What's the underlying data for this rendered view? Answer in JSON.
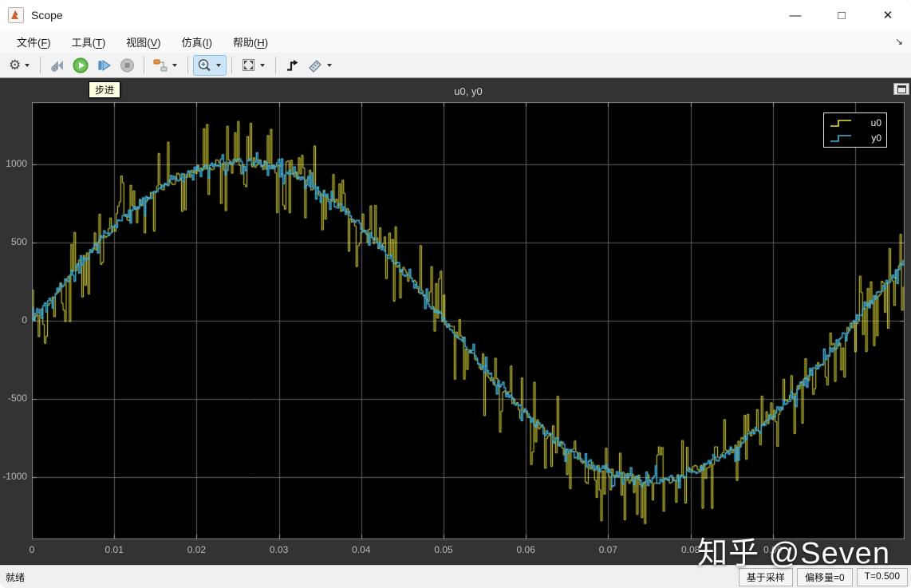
{
  "window": {
    "title": "Scope",
    "controls": {
      "minimize": "—",
      "maximize": "□",
      "close": "✕"
    },
    "menu_overflow_arrow": "↘"
  },
  "menu": {
    "items": [
      {
        "text": "文件",
        "key": "F"
      },
      {
        "text": "工具",
        "key": "T"
      },
      {
        "text": "视图",
        "key": "V"
      },
      {
        "text": "仿真",
        "key": "I"
      },
      {
        "text": "帮助",
        "key": "H"
      }
    ]
  },
  "toolbar": {
    "tooltip": "步进",
    "buttons": [
      "settings",
      "step-back",
      "run",
      "step-forward",
      "stop",
      "signal-selector",
      "zoom",
      "fit-to-view",
      "trigger",
      "measurements"
    ],
    "active_button": "zoom"
  },
  "chart_data": {
    "type": "line",
    "title": "u0, y0",
    "xlim": [
      0,
      0.106
    ],
    "ylim": [
      -1400,
      1400
    ],
    "x_ticks": [
      0,
      0.01,
      0.02,
      0.03,
      0.04,
      0.05,
      0.06,
      0.07,
      0.08,
      0.09
    ],
    "x_tick_labels": [
      "0",
      "0.01",
      "0.02",
      "0.03",
      "0.04",
      "0.05",
      "0.06",
      "0.07",
      "0.08",
      "0.09"
    ],
    "x_grid_step": 0.01,
    "y_ticks": [
      1000,
      500,
      0,
      -500,
      -1000
    ],
    "y_tick_labels": [
      "1000",
      "500",
      "0",
      "-500",
      "-1000"
    ],
    "grid": true,
    "background": "#000000",
    "grid_color": "#606060",
    "axis_border_color": "#8a8a8a",
    "tick_mark_color": "#a8a8a8",
    "legend_position": "top-right",
    "samples": 560,
    "seed": 1337,
    "series": [
      {
        "name": "u0",
        "color": "#e6e13c",
        "waveform": "sine",
        "amplitude": 1020,
        "frequency_hz": 10,
        "render": "sample-hold",
        "noise_jitter": 35,
        "impulse_prob": 0.32,
        "impulse_min": 70,
        "impulse_max": 300
      },
      {
        "name": "y0",
        "color": "#44b4de",
        "waveform": "sine",
        "amplitude": 1020,
        "frequency_hz": 10,
        "render": "sample-hold",
        "noise_jitter": 26,
        "impulse_prob": 0.12,
        "impulse_min": 30,
        "impulse_max": 80
      }
    ]
  },
  "legend": {
    "entries": [
      {
        "label": "u0",
        "color": "#e6e13c"
      },
      {
        "label": "y0",
        "color": "#44b4de"
      }
    ]
  },
  "statusbar": {
    "left": "就绪",
    "segments": [
      "基于采样",
      "偏移量=0",
      "T=0.500"
    ]
  },
  "watermark": "知乎 @Seven"
}
